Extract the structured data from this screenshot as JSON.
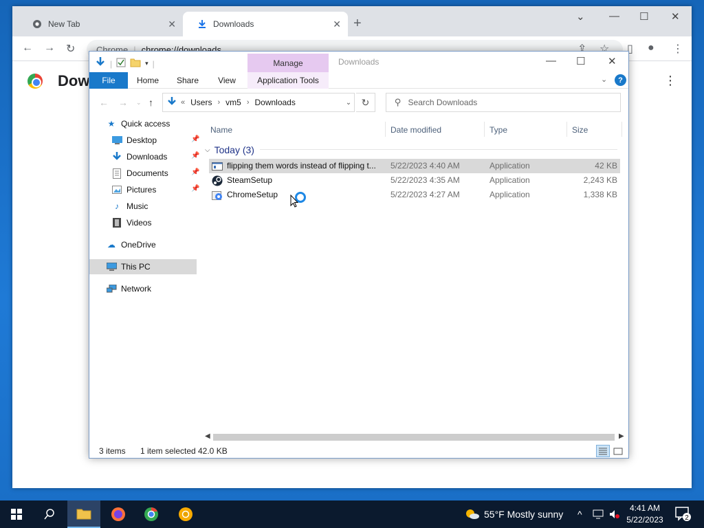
{
  "chrome": {
    "tabs": [
      {
        "label": "New Tab",
        "icon": "chrome-icon"
      },
      {
        "label": "Downloads",
        "icon": "download-icon"
      }
    ],
    "omnibox": {
      "site": "Chrome",
      "url": "chrome://downloads"
    },
    "page_title": "Dow"
  },
  "explorer": {
    "manage_label": "Manage",
    "caption": "Downloads",
    "ribbon_tabs": [
      "File",
      "Home",
      "Share",
      "View",
      "Application Tools"
    ],
    "address": {
      "prefix": "«",
      "crumbs": [
        "Users",
        "vm5",
        "Downloads"
      ]
    },
    "search_placeholder": "Search Downloads",
    "nav": {
      "quick_access": "Quick access",
      "desktop": "Desktop",
      "downloads": "Downloads",
      "documents": "Documents",
      "pictures": "Pictures",
      "music": "Music",
      "videos": "Videos",
      "onedrive": "OneDrive",
      "this_pc": "This PC",
      "network": "Network"
    },
    "columns": {
      "name": "Name",
      "date": "Date modified",
      "type": "Type",
      "size": "Size"
    },
    "group": "Today (3)",
    "files": [
      {
        "name": "flipping them words instead of flipping t...",
        "date": "5/22/2023 4:40 AM",
        "type": "Application",
        "size": "42 KB",
        "selected": true
      },
      {
        "name": "SteamSetup",
        "date": "5/22/2023 4:35 AM",
        "type": "Application",
        "size": "2,243 KB",
        "selected": false
      },
      {
        "name": "ChromeSetup",
        "date": "5/22/2023 4:27 AM",
        "type": "Application",
        "size": "1,338 KB",
        "selected": false
      }
    ],
    "status": {
      "items": "3 items",
      "selected": "1 item selected",
      "size": "42.0 KB"
    }
  },
  "taskbar": {
    "weather": "55°F  Mostly sunny",
    "time": "4:41 AM",
    "date": "5/22/2023",
    "notification_count": "2"
  },
  "colors": {
    "accent": "#1979ca",
    "manage": "#e6c9f0",
    "taskbar": "#0b1a2e"
  }
}
